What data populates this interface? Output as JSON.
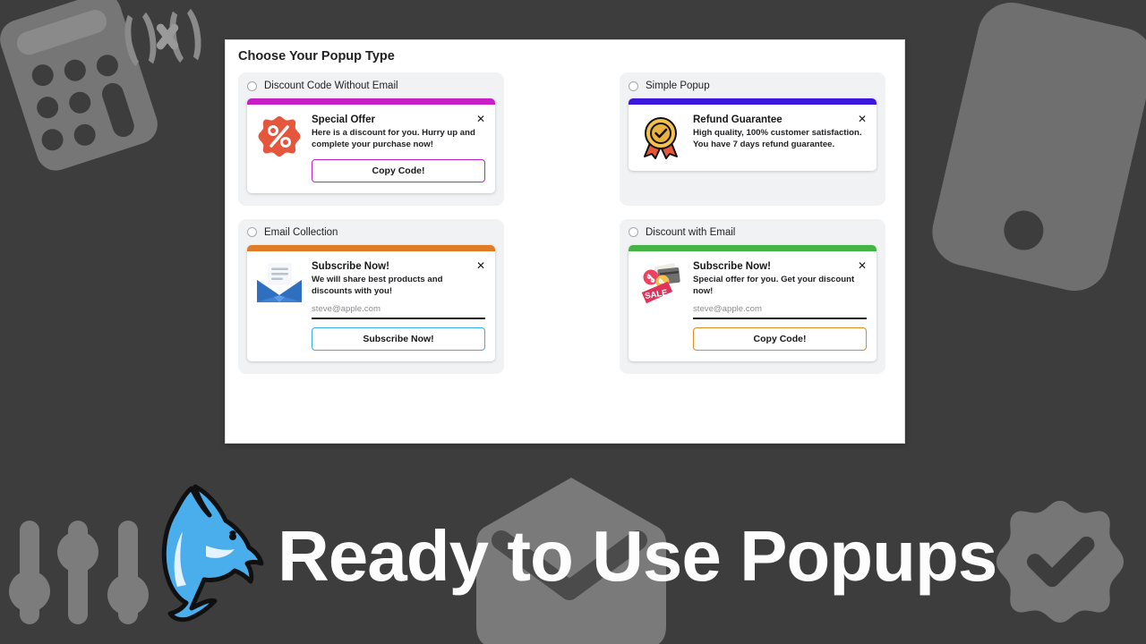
{
  "banner": {
    "headline": "Ready to Use Popups",
    "logo_icon": "dolphin-icon",
    "decorations": [
      "calculator-icon",
      "formula-x-icon",
      "phone-icon",
      "sliders-icon",
      "envelope-icon",
      "verified-check-badge-icon"
    ]
  },
  "panel": {
    "title": "Choose Your Popup Type",
    "options": [
      {
        "id": "discount-code-without-email",
        "label": "Discount Code Without Email",
        "selected": false,
        "accent": "#c51fc5",
        "icon": "discount-percent-badge-icon",
        "popup": {
          "title": "Special Offer",
          "description": "Here is a discount for you. Hurry up and complete your purchase now!",
          "close_label": "✕",
          "has_email": false,
          "email_placeholder": "",
          "cta_label": "Copy Code!",
          "cta_border": "#c51fc5"
        }
      },
      {
        "id": "simple-popup",
        "label": "Simple Popup",
        "selected": false,
        "accent": "#3d16e0",
        "icon": "medal-check-icon",
        "popup": {
          "title": "Refund Guarantee",
          "description": "High quality, 100% customer satisfaction. You have 7 days refund guarantee.",
          "close_label": "✕",
          "has_email": false,
          "email_placeholder": "",
          "cta_label": "",
          "cta_border": ""
        }
      },
      {
        "id": "email-collection",
        "label": "Email Collection",
        "selected": false,
        "accent": "#e07c26",
        "icon": "open-envelope-icon",
        "popup": {
          "title": "Subscribe Now!",
          "description": "We will share best products and discounts with you!",
          "close_label": "✕",
          "has_email": true,
          "email_placeholder": "steve@apple.com",
          "cta_label": "Subscribe Now!",
          "cta_border": "#35afe8"
        }
      },
      {
        "id": "discount-with-email",
        "label": "Discount with Email",
        "selected": false,
        "accent": "#44b545",
        "icon": "sale-tag-icon",
        "popup": {
          "title": "Subscribe Now!",
          "description": "Special offer for you. Get your discount now!",
          "close_label": "✕",
          "has_email": true,
          "email_placeholder": "steve@apple.com",
          "cta_label": "Copy Code!",
          "cta_border": "#e08b22"
        }
      }
    ]
  },
  "colors": {
    "background": "#3d3d3d",
    "panel_bg": "#ffffff",
    "card_bg": "#f1f2f4",
    "banner_text": "#fdfdfd",
    "dolphin": "#4aaeed"
  }
}
